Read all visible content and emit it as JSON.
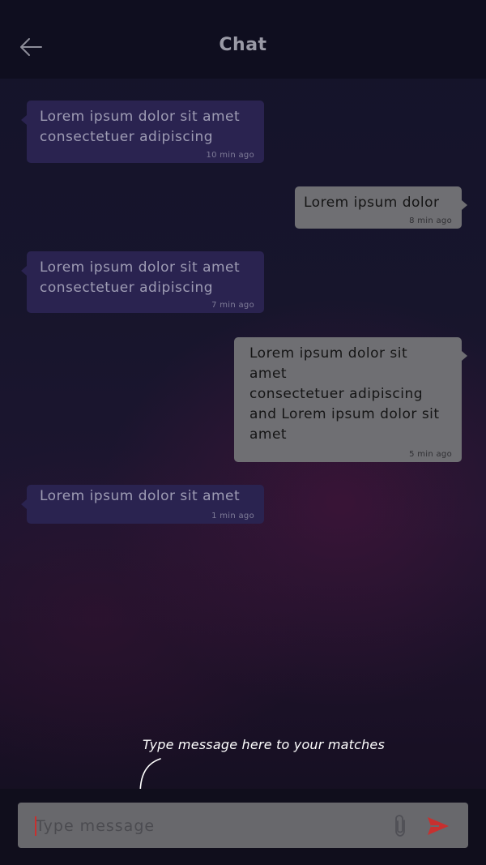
{
  "header": {
    "title": "Chat",
    "back_icon": "arrow-left-icon"
  },
  "messages": [
    {
      "direction": "incoming",
      "text": "Lorem ipsum dolor sit amet\nconsectetuer adipiscing",
      "time": "10 min ago"
    },
    {
      "direction": "outgoing",
      "text": "Lorem ipsum dolor",
      "time": "8 min ago"
    },
    {
      "direction": "incoming",
      "text": "Lorem ipsum dolor sit amet\nconsectetuer adipiscing",
      "time": "7 min ago"
    },
    {
      "direction": "outgoing",
      "text": "Lorem ipsum dolor sit\namet\nconsectetuer adipiscing\nand Lorem ipsum dolor sit\namet",
      "time": "5 min ago"
    },
    {
      "direction": "incoming",
      "text": "Lorem ipsum dolor sit amet",
      "time": "1 min ago"
    }
  ],
  "hint": {
    "text": "Type message here to your matches"
  },
  "composer": {
    "placeholder": "Type message",
    "value": "",
    "attach_icon": "paperclip-icon",
    "send_icon": "send-icon"
  },
  "colors": {
    "send_accent": "#c8302f",
    "incoming_bubble": "#2a2350",
    "outgoing_bubble": "#6f6f73"
  }
}
